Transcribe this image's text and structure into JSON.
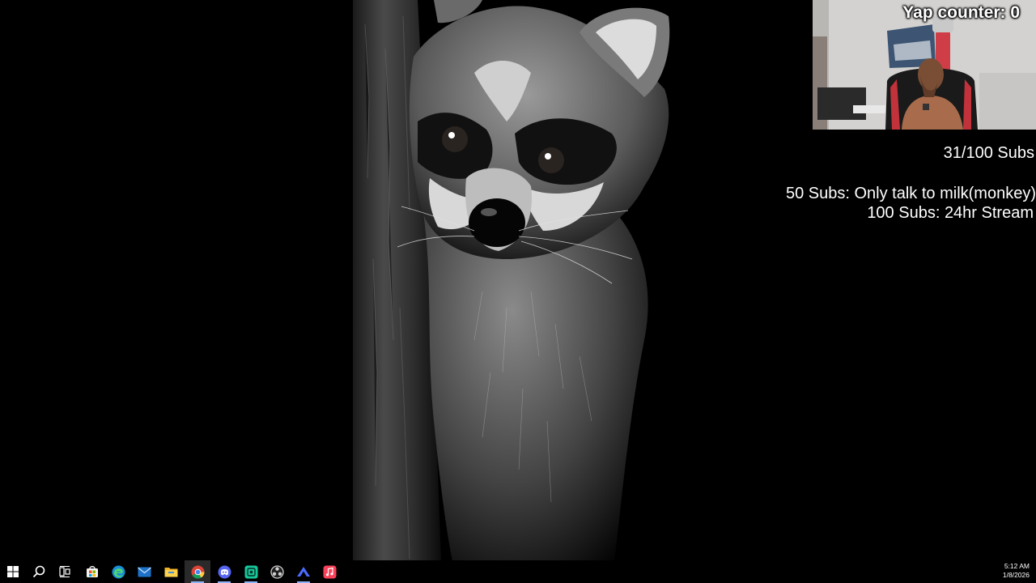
{
  "overlay": {
    "yap_counter": "Yap counter: 0",
    "subs_progress": "31/100 Subs",
    "subs_current": 31,
    "subs_goal": 100,
    "goals": [
      "50 Subs: Only talk to milk(monkey)",
      "100 Subs: 24hr Stream"
    ]
  },
  "wallpaper": {
    "subject": "raccoon-peeking-from-tree"
  },
  "taskbar": {
    "items": [
      {
        "name": "start-button",
        "icon": "windows-logo-icon"
      },
      {
        "name": "search-button",
        "icon": "search-icon"
      },
      {
        "name": "task-view-button",
        "icon": "task-view-icon"
      },
      {
        "name": "microsoft-store",
        "icon": "store-icon"
      },
      {
        "name": "edge",
        "icon": "edge-icon"
      },
      {
        "name": "mail",
        "icon": "mail-icon"
      },
      {
        "name": "file-explorer",
        "icon": "folder-icon"
      },
      {
        "name": "chrome",
        "icon": "chrome-icon"
      },
      {
        "name": "discord",
        "icon": "discord-icon"
      },
      {
        "name": "app-green",
        "icon": "green-app-icon"
      },
      {
        "name": "obs",
        "icon": "obs-icon"
      },
      {
        "name": "app-blue",
        "icon": "blue-chevron-app-icon"
      },
      {
        "name": "itunes",
        "icon": "music-icon"
      }
    ],
    "clock": {
      "time": "5:12 AM",
      "date": "1/8/2026"
    }
  },
  "colors": {
    "desktop_bg": "#000000",
    "taskbar_bg": "#000000",
    "active_indicator": "#8ab4f8"
  }
}
